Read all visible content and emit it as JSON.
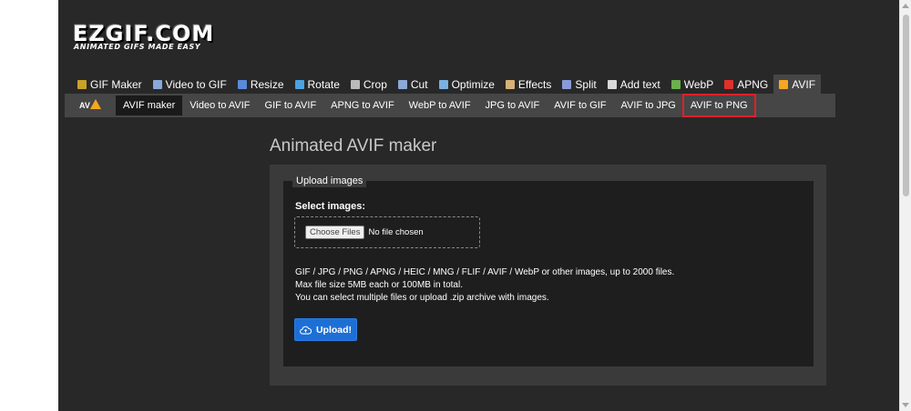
{
  "logo": {
    "main": "EZGIF.COM",
    "tagline": "ANIMATED GIFS MADE EASY"
  },
  "main_nav": [
    {
      "label": "GIF Maker",
      "icon": "gif-maker-icon",
      "color": "#c9a227"
    },
    {
      "label": "Video to GIF",
      "icon": "video-icon",
      "color": "#8aa8d8"
    },
    {
      "label": "Resize",
      "icon": "resize-icon",
      "color": "#5a8ad8"
    },
    {
      "label": "Rotate",
      "icon": "rotate-icon",
      "color": "#4ba3e3"
    },
    {
      "label": "Crop",
      "icon": "crop-icon",
      "color": "#bbbbbb"
    },
    {
      "label": "Cut",
      "icon": "cut-icon",
      "color": "#8aa8d8"
    },
    {
      "label": "Optimize",
      "icon": "optimize-icon",
      "color": "#7ab0e0"
    },
    {
      "label": "Effects",
      "icon": "effects-icon",
      "color": "#d8b078"
    },
    {
      "label": "Split",
      "icon": "split-icon",
      "color": "#8a9ad8"
    },
    {
      "label": "Add text",
      "icon": "add-text-icon",
      "color": "#d8d8d8"
    },
    {
      "label": "WebP",
      "icon": "webp-icon",
      "color": "#6ab04c"
    },
    {
      "label": "APNG",
      "icon": "apng-icon",
      "color": "#e0302a"
    },
    {
      "label": "AVIF",
      "icon": "avif-icon",
      "color": "#f5a623",
      "active": true
    }
  ],
  "sub_nav": {
    "logo_text": "AV",
    "items": [
      {
        "label": "AVIF maker",
        "active": true
      },
      {
        "label": "Video to AVIF"
      },
      {
        "label": "GIF to AVIF"
      },
      {
        "label": "APNG to AVIF"
      },
      {
        "label": "WebP to AVIF"
      },
      {
        "label": "JPG to AVIF"
      },
      {
        "label": "AVIF to GIF"
      },
      {
        "label": "AVIF to JPG"
      },
      {
        "label": "AVIF to PNG",
        "highlight": true
      }
    ]
  },
  "page_title": "Animated AVIF maker",
  "upload": {
    "legend": "Upload images",
    "select_label": "Select images:",
    "choose_button": "Choose Files",
    "no_file": "No file chosen",
    "info_lines": [
      "GIF / JPG / PNG / APNG / HEIC / MNG / FLIF / AVIF / WebP or other images, up to 2000 files.",
      "Max file size 5MB each or 100MB in total.",
      "You can select multiple files or upload .zip archive with images."
    ],
    "upload_button": "Upload!"
  },
  "colors": {
    "accent_blue": "#1d6fd6",
    "highlight_red": "#e0202a",
    "page_bg": "#282828"
  }
}
